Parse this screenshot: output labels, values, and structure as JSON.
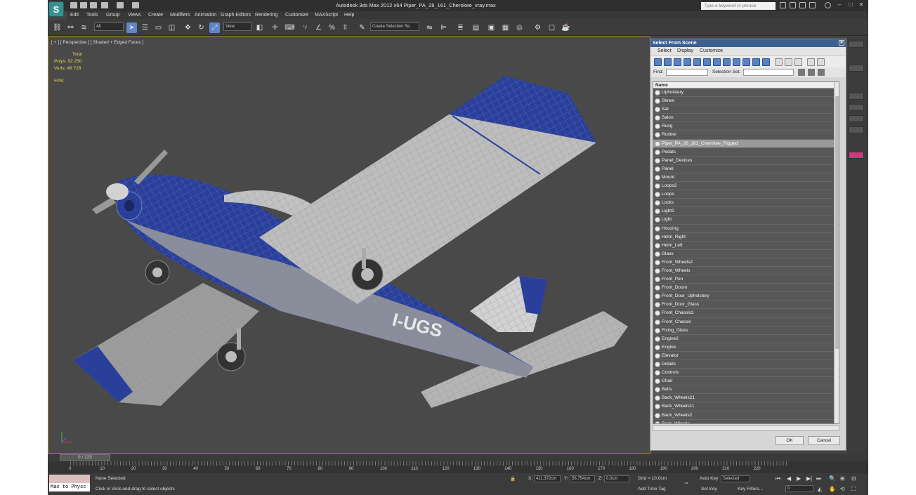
{
  "app": {
    "logo": "S",
    "title": "Autodesk 3ds Max  2012 x64     Piper_PA_28_161_Cherokee_vray.max",
    "search_placeholder": "Type a keyword or phrase"
  },
  "menu": [
    "Edit",
    "Tools",
    "Group",
    "Views",
    "Create",
    "Modifiers",
    "Animation",
    "Graph Editors",
    "Rendering",
    "Customize",
    "MAXScript",
    "Help"
  ],
  "toolbar": {
    "filter_value": "All",
    "refcoord_value": "View",
    "selection_set_placeholder": "Create Selection Se"
  },
  "viewport": {
    "label": "[ + ] [ Perspective ] [ Shaded + Edged Faces ]",
    "stats_total": "Total",
    "polys_label": "Polys:",
    "polys_value": "92 250",
    "verts_label": "Verts:",
    "verts_value": "48 728",
    "fps_label": "FPS:",
    "tail_number": "I-UGS"
  },
  "dialog": {
    "title": "Select From Scene",
    "menus": [
      "Select",
      "Display",
      "Customize"
    ],
    "find_label": "Find:",
    "selset_label": "Selection Set:",
    "column_name": "Name",
    "selected_index": 6,
    "items": [
      "Upholstery",
      "Skrew",
      "Sat",
      "Salon",
      "Rung",
      "Rudder",
      "Piper_PA_28_161_Cherokee_Rigged",
      "Pedals",
      "Panel_Devices",
      "Panel",
      "Mount",
      "Loops2",
      "Loops",
      "Locks",
      "Light2",
      "Light",
      "Housing",
      "Helm_Right",
      "Helm_Left",
      "Glass",
      "Front_Wheels2",
      "Front_Wheels",
      "Front_Pen",
      "Front_Doorn",
      "Front_Door_Upholstery",
      "Front_Door_Glass",
      "Front_Chassis2",
      "Front_Chassis",
      "Fixing_Glass",
      "Engine2",
      "Engine",
      "Elevator",
      "Details",
      "Controls",
      "Chair",
      "Belts",
      "Back_Wheels21",
      "Back_Wheels11",
      "Back_Wheels2",
      "Back_Wheels"
    ],
    "ok_label": "OK",
    "cancel_label": "Cancel"
  },
  "timeline": {
    "frame_slider": "0 / 225",
    "ticks": [
      "0",
      "10",
      "20",
      "30",
      "40",
      "50",
      "60",
      "70",
      "80",
      "90",
      "100",
      "110",
      "120",
      "130",
      "140",
      "150",
      "160",
      "170",
      "180",
      "190",
      "200",
      "210",
      "220"
    ]
  },
  "status": {
    "maxscript_text": "Max to Physc",
    "selection_text": "None Selected",
    "prompt_text": "Click or click-and-drag to select objects",
    "x_label": "X:",
    "x_value": "411,372cm",
    "y_label": "Y:",
    "y_value": "56,754cm",
    "z_label": "Z:",
    "z_value": "0,0cm",
    "grid_text": "Grid = 10,0cm",
    "add_time_tag": "Add Time Tag",
    "auto_key": "Auto Key",
    "set_key": "Set Key",
    "selected_value": "Selected",
    "key_filters": "Key Filters...",
    "frame_value": "0"
  },
  "colors": {
    "accent": "#5f86c8",
    "viewport_border": "#b58a1e",
    "plane_blue": "#2a3f9a"
  }
}
